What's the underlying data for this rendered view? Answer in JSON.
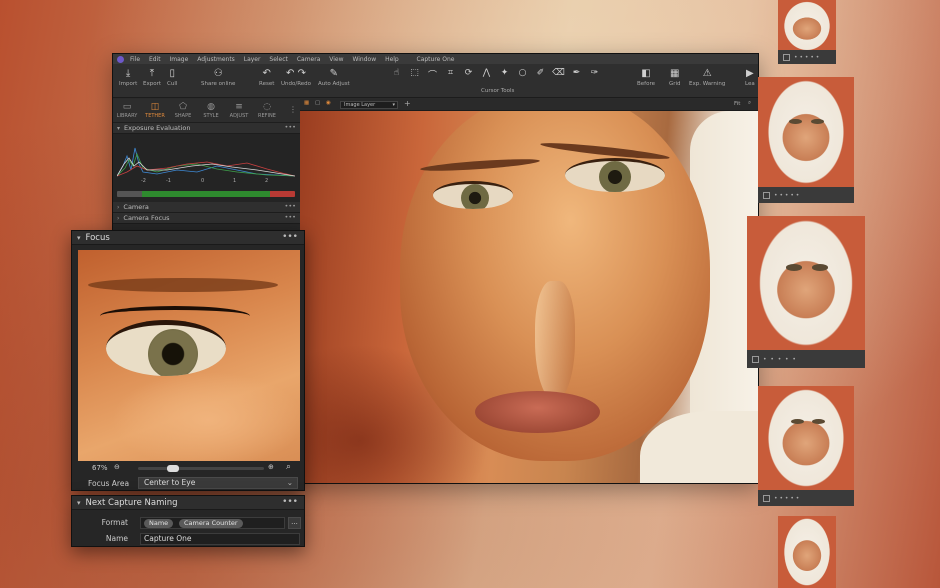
{
  "window": {
    "title": "Capture One",
    "menu": [
      "File",
      "Edit",
      "Image",
      "Adjustments",
      "Layer",
      "Select",
      "Camera",
      "View",
      "Window",
      "Help"
    ]
  },
  "toolbar": {
    "import": "Import",
    "export": "Export",
    "cull": "Cull",
    "share": "Share online",
    "reset": "Reset",
    "undo_redo": "Undo/Redo",
    "auto_adjust": "Auto Adjust",
    "cursor_tools": "Cursor Tools",
    "before": "Before",
    "grid": "Grid",
    "exp_warning": "Exp. Warning",
    "learn": "Lea"
  },
  "tool_tabs": [
    "LIBRARY",
    "TETHER",
    "SHAPE",
    "STYLE",
    "ADJUST",
    "REFINE"
  ],
  "active_tab": "TETHER",
  "left_panel": {
    "exposure_title": "Exposure Evaluation",
    "scale": [
      "-2",
      "-1",
      "0",
      "1",
      "2"
    ],
    "camera": "Camera",
    "camera_focus": "Camera Focus"
  },
  "viewer": {
    "layer": "Image Layer",
    "fit": "Fit"
  },
  "focus_panel": {
    "title": "Focus",
    "zoom": "67%",
    "area_label": "Focus Area",
    "area_value": "Center to Eye",
    "zoom_level": 0.25
  },
  "naming_panel": {
    "title": "Next Capture Naming",
    "format_label": "Format",
    "tokens": [
      "Name",
      "Camera Counter"
    ],
    "more": "...",
    "name_label": "Name",
    "name_value": "Capture One"
  },
  "colors": {
    "accent": "#e08a3c",
    "panel": "#262626",
    "toolbar": "#2f2f2f"
  },
  "icons": [
    "app-icon",
    "import-icon",
    "export-icon",
    "cull-icon",
    "share-icon",
    "reset-icon",
    "undo-icon",
    "redo-icon",
    "auto-adjust-icon",
    "before-icon",
    "grid-icon",
    "warning-icon",
    "zoom-out-icon",
    "zoom-in-icon",
    "loupe-icon"
  ]
}
